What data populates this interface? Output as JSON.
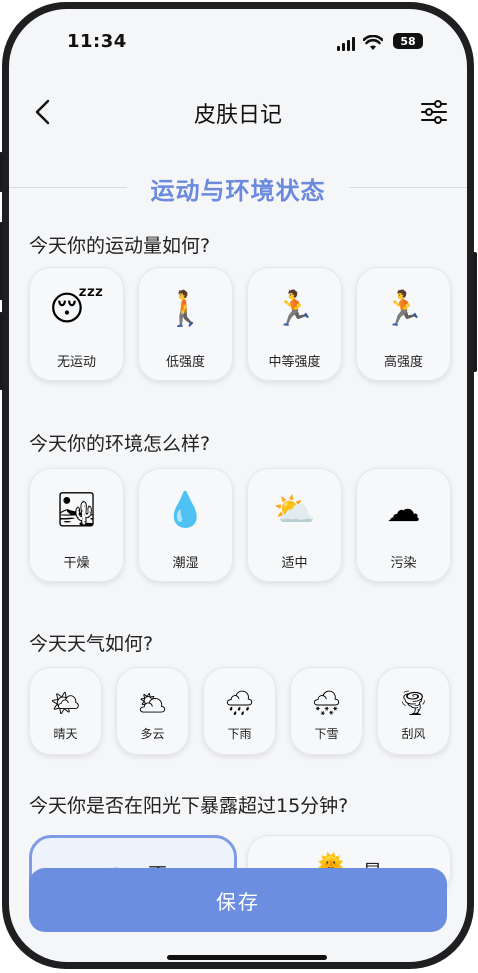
{
  "status_bar": {
    "time": "11:34",
    "battery": "58"
  },
  "header": {
    "title": "皮肤日记"
  },
  "section": {
    "title": "运动与环境状态"
  },
  "exercise": {
    "question": "今天你的运动量如何?",
    "options": [
      {
        "label": "无运动",
        "icon": "😴"
      },
      {
        "label": "低强度",
        "icon": "🚶"
      },
      {
        "label": "中等强度",
        "icon": "🏃"
      },
      {
        "label": "高强度",
        "icon": "🏃"
      }
    ]
  },
  "environment": {
    "question": "今天你的环境怎么样?",
    "options": [
      {
        "label": "干燥",
        "icon": "🏜"
      },
      {
        "label": "潮湿",
        "icon": "💧"
      },
      {
        "label": "适中",
        "icon": "⛅"
      },
      {
        "label": "污染",
        "icon": "☁"
      }
    ]
  },
  "weather": {
    "question": "今天天气如何?",
    "options": [
      {
        "label": "晴天",
        "icon": "🌤"
      },
      {
        "label": "多云",
        "icon": "🌥"
      },
      {
        "label": "下雨",
        "icon": "🌧"
      },
      {
        "label": "下雪",
        "icon": "🌨"
      },
      {
        "label": "刮风",
        "icon": "🌪"
      }
    ]
  },
  "sun_exposure": {
    "question": "今天你是否在阳光下暴露超过15分钟?",
    "options": [
      {
        "label": "否",
        "icon": "☁",
        "selected": true
      },
      {
        "label": "是",
        "icon": "🌞",
        "selected": false
      }
    ]
  },
  "actions": {
    "save_label": "保存"
  },
  "colors": {
    "accent": "#6b8ee0",
    "section_title": "#6b8ade",
    "selected_border": "#7d9be6"
  }
}
